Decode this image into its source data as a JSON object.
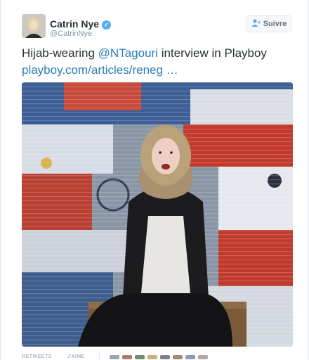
{
  "author": {
    "name": "Catrin Nye",
    "handle": "@CatrinNye",
    "verified_icon": "verified-badge-icon"
  },
  "follow_button": {
    "label": "Suivre",
    "icon": "add-user-icon"
  },
  "tweet": {
    "text_prefix": "Hijab-wearing ",
    "mention": "@NTagouri",
    "text_suffix": " interview in Playboy",
    "link": "playboy.com/articles/reneg …"
  },
  "photo": {
    "alt": "photo"
  },
  "stats": {
    "retweets_label": "RETWEETS",
    "likes_label": "J'AIME"
  },
  "colors": {
    "link": "#2b7bb9",
    "accent": "#55acee",
    "text": "#292f33",
    "muted": "#8899a6"
  }
}
